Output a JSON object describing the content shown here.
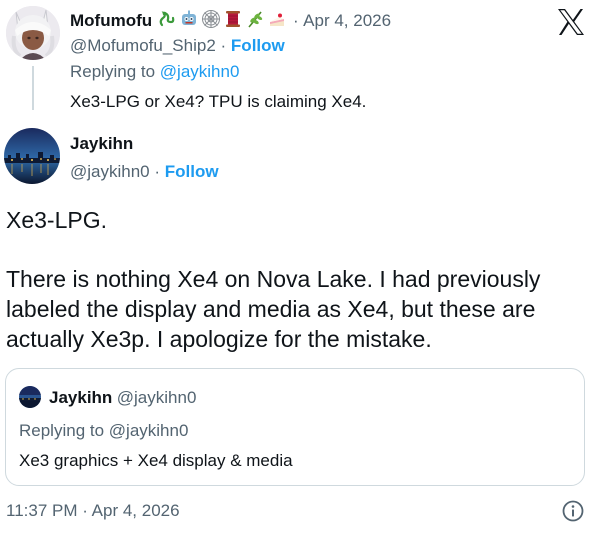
{
  "parent_tweet": {
    "display_name": "Mofumofu",
    "emoji_icons": [
      "dragon-icon",
      "robot-icon",
      "spiderweb-icon",
      "thread-spool-icon",
      "herb-icon",
      "cake-icon"
    ],
    "date_sep": "·",
    "date": "Apr 4, 2026",
    "handle": "@Mofumofu_Ship2",
    "handle_sep": "·",
    "follow_label": "Follow",
    "replying_prefix": "Replying to ",
    "replying_handle": "@jaykihn0",
    "text": "Xe3-LPG or Xe4? TPU is claiming Xe4."
  },
  "main_tweet": {
    "display_name": "Jaykihn",
    "handle": "@jaykihn0",
    "handle_sep": "·",
    "follow_label": "Follow",
    "text_line1": "Xe3-LPG.",
    "text_para2": "There is nothing Xe4 on Nova Lake. I had previously labeled the display and media as Xe4, but these are actually Xe3p. I apologize for the mistake.",
    "timestamp": "11:37 PM · Apr 4, 2026"
  },
  "quoted_tweet": {
    "display_name": "Jaykihn",
    "handle": "@jaykihn0",
    "replying_prefix": "Replying to ",
    "replying_handle": "@jaykihn0",
    "text": "Xe3 graphics + Xe4 display & media"
  },
  "icons": {
    "brand": "x-logo-icon",
    "info": "info-icon"
  },
  "colors": {
    "link": "#1d9bf0",
    "secondary_text": "#536471",
    "primary_text": "#0f1419",
    "border": "#cfd9de"
  }
}
